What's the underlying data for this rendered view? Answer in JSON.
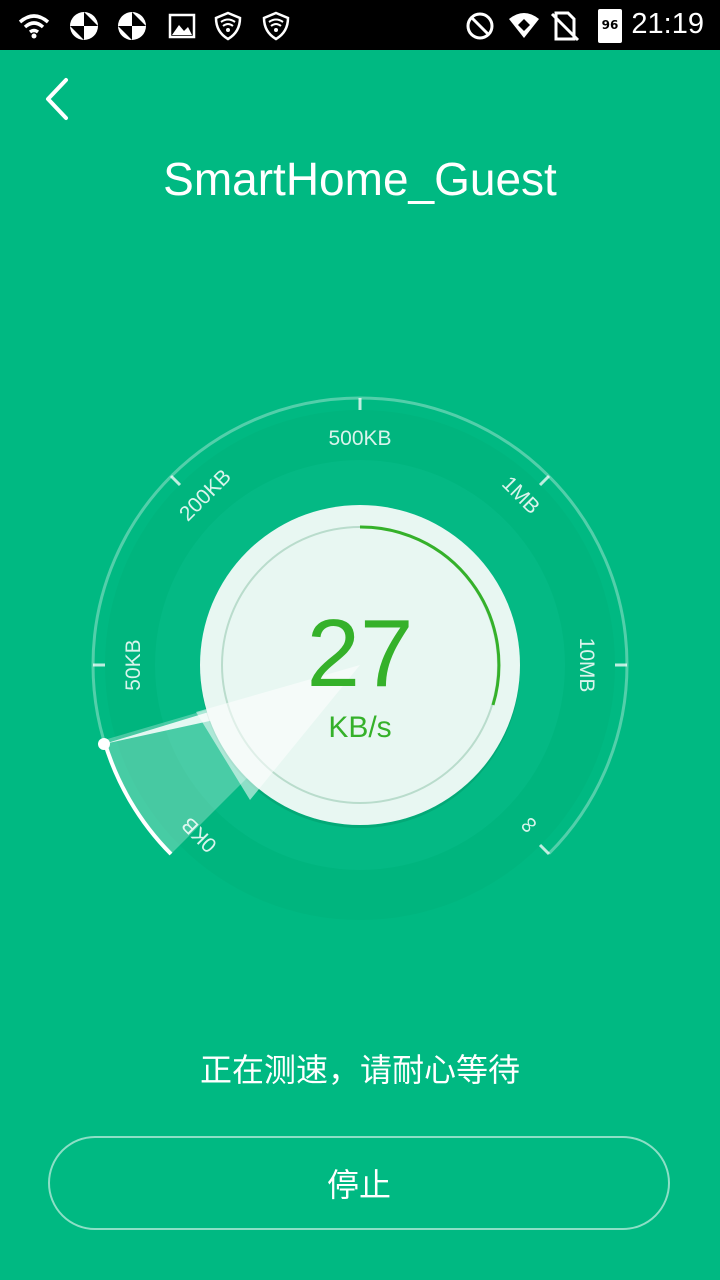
{
  "status_bar": {
    "time": "21:19",
    "battery_level": "96",
    "icons": [
      "wifi-icon",
      "vpn-icon",
      "vpn-icon",
      "image-icon",
      "shield-icon",
      "shield-icon",
      "do-not-disturb-icon",
      "wifi-signal-icon",
      "no-sim-icon",
      "battery-icon"
    ]
  },
  "header": {
    "back_icon": "chevron-left-icon",
    "title": "SmartHome_Guest"
  },
  "speedometer": {
    "value": "27",
    "unit": "KB/s",
    "scale_labels": [
      "0KB",
      "50KB",
      "200KB",
      "500KB",
      "1MB",
      "10MB",
      "∞"
    ],
    "needle_position_fraction": 0.04
  },
  "status_text": "正在测速，请耐心等待",
  "stop_button_label": "停止",
  "colors": {
    "background": "#00b982",
    "value_text": "#35b12a",
    "dial_face": "#e8f7f2"
  }
}
